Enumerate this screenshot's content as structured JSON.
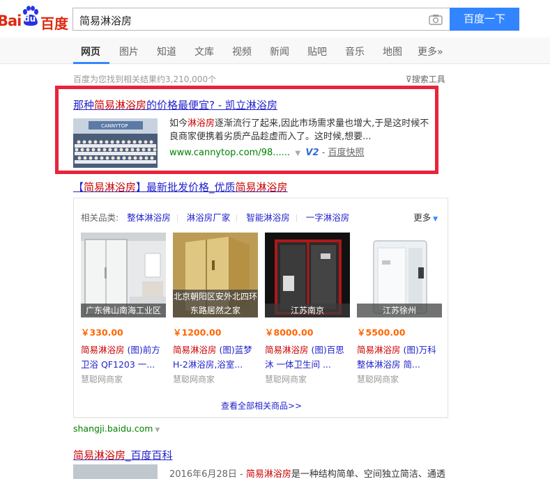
{
  "logo": {
    "bai": "Bai",
    "du": "du",
    "chars": "百度"
  },
  "search": {
    "query": "简易淋浴房",
    "button": "百度一下"
  },
  "tabs": [
    {
      "label": "网页",
      "active": true
    },
    {
      "label": "图片"
    },
    {
      "label": "知道"
    },
    {
      "label": "文库"
    },
    {
      "label": "视频"
    },
    {
      "label": "新闻"
    },
    {
      "label": "贴吧"
    },
    {
      "label": "音乐"
    },
    {
      "label": "地图"
    },
    {
      "label": "更多»"
    }
  ],
  "result_count": "百度为您找到相关结果约3,210,000个",
  "search_tools": "搜索工具",
  "result1": {
    "title_pre": "那种",
    "title_em": "简易淋浴房",
    "title_post": "的价格最便宜? - 凯立淋浴房",
    "abstract_pre": "如今",
    "abstract_em": "淋浴房",
    "abstract_post": "逐渐流行了起来,因此市场需求量也增大,于是这时候不良商家便携着劣质产品趁虚而入了。这时候,想要...",
    "url": "www.cannytop.com/98......",
    "v2": "V2",
    "snapshot": "百度快照",
    "image_label": "CANNYTOP"
  },
  "result2": {
    "title_pre": "【",
    "title_em1": "简易淋浴房",
    "title_mid": "】最新批发价格_优质",
    "title_em2": "简易淋浴房",
    "category_label": "相关品类:",
    "categories": [
      "整体淋浴房",
      "淋浴房厂家",
      "智能淋浴房",
      "一字淋浴房"
    ],
    "more": "更多",
    "products": [
      {
        "caption": "广东佛山南海工业区",
        "price": "￥330.00",
        "name_em": "简易淋浴房",
        "name_rest": " (图)前方卫浴 QF1203 一...",
        "shop": "慧聪网商家"
      },
      {
        "caption": "北京朝阳区安外北四环东路居然之家",
        "price": "￥1200.00",
        "name_em": "简易淋浴房",
        "name_rest": " (图)蓝梦H-2淋浴房,浴室...",
        "shop": "慧聪网商家"
      },
      {
        "caption": "江苏南京",
        "price": "￥8000.00",
        "name_em": "简易淋浴房",
        "name_rest": " (图)百思沐 一体卫生间 ...",
        "shop": "慧聪网商家"
      },
      {
        "caption": "江苏徐州",
        "price": "￥5500.00",
        "name_em": "简易淋浴房",
        "name_rest": " (图)万科整体淋浴房 简...",
        "shop": "慧聪网商家"
      }
    ],
    "see_all": "查看全部相关商品>>",
    "url": "shangji.baidu.com"
  },
  "result3": {
    "title_em": "简易淋浴房",
    "title_post": "_百度百科",
    "date": "2016年6月28日 - ",
    "abstract_em": "简易淋浴房",
    "abstract_post": "是一种结构简单、空间独立简洁、通透"
  },
  "colors": {
    "accent": "#3385ff",
    "link": "#2222cc",
    "highlight": "#c00",
    "frame": "#e8243c",
    "url": "#008000",
    "price": "#ff6600"
  }
}
